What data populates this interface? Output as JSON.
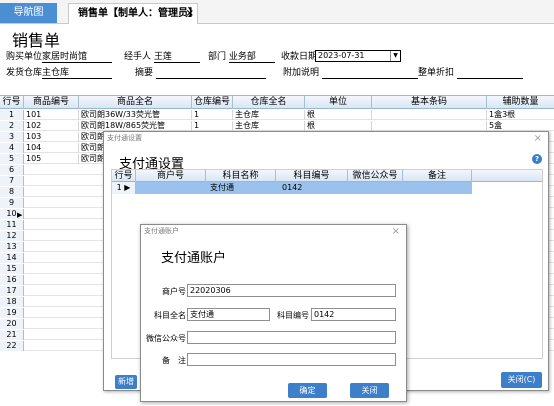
{
  "tabs": {
    "nav_label": "导航图",
    "order_label": "销售单【制单人：管理员】",
    "close_glyph": "×"
  },
  "header": {
    "title": "销售单",
    "buyer_label": "购买单位",
    "buyer_value": "家居时尚馆",
    "handler_label": "经手人",
    "handler_value": "王莲",
    "dept_label": "部门",
    "dept_value": "业务部",
    "date_label": "收款日期",
    "date_value": "2023-07-31",
    "warehouse_label": "发货仓库",
    "warehouse_value": "主仓库",
    "summary_label": "摘要",
    "note_label": "附加说明",
    "discount_label": "整单折扣"
  },
  "grid": {
    "columns": [
      "行号",
      "商品编号",
      "商品全名",
      "仓库编号",
      "仓库全名",
      "单位",
      "基本条码",
      "辅助数量"
    ],
    "rows": [
      {
        "no": "1",
        "code": "101",
        "name": "欧司朗36W/33荧光管",
        "wh_code": "1",
        "wh_name": "主仓库",
        "unit": "根",
        "barcode": "",
        "aux_qty": "1盒3根"
      },
      {
        "no": "2",
        "code": "102",
        "name": "欧司朗18W/865荧光管",
        "wh_code": "1",
        "wh_name": "主仓库",
        "unit": "根",
        "barcode": "",
        "aux_qty": "5盒"
      },
      {
        "no": "3",
        "code": "103",
        "name": "欧司朗",
        "wh_code": "",
        "wh_name": "",
        "unit": "",
        "barcode": "",
        "aux_qty": ""
      },
      {
        "no": "4",
        "code": "104",
        "name": "欧司朗",
        "wh_code": "",
        "wh_name": "",
        "unit": "",
        "barcode": "",
        "aux_qty": ""
      },
      {
        "no": "5",
        "code": "105",
        "name": "欧司朗",
        "wh_code": "",
        "wh_name": "",
        "unit": "",
        "barcode": "",
        "aux_qty": ""
      }
    ],
    "row_numbers": [
      "6",
      "7",
      "8",
      "9",
      "10",
      "11",
      "12",
      "13",
      "14",
      "15",
      "16",
      "17",
      "18",
      "19",
      "20",
      "21",
      "22"
    ]
  },
  "dialog_settings": {
    "caption": "支付通设置",
    "title": "支付通设置",
    "help_glyph": "?",
    "close_glyph": "×",
    "columns": [
      "行号",
      "商户号",
      "科目名称",
      "科目编号",
      "微信公众号",
      "备注"
    ],
    "row": {
      "no": "1",
      "merchant": "",
      "subject_name": "支付通",
      "subject_code": "0142",
      "wechat": "",
      "remark": ""
    },
    "new_button": "新增",
    "close_button": "关闭(C)"
  },
  "dialog_account": {
    "caption": "支付通账户",
    "title": "支付通账户",
    "close_glyph": "×",
    "merchant_label": "商户号",
    "merchant_value": "22020306",
    "subject_name_label": "科目全名",
    "subject_name_value": "支付通",
    "subject_code_label": "科目编号",
    "subject_code_value": "0142",
    "wechat_label": "微信公众号",
    "wechat_value": "",
    "remark_label": "备　注",
    "remark_value": "",
    "ok_button": "确定",
    "close_button": "关闭"
  },
  "colors": {
    "accent": "#3d7fc9",
    "selection": "#9ac2ec",
    "grid_header": "#d9e6f4"
  }
}
